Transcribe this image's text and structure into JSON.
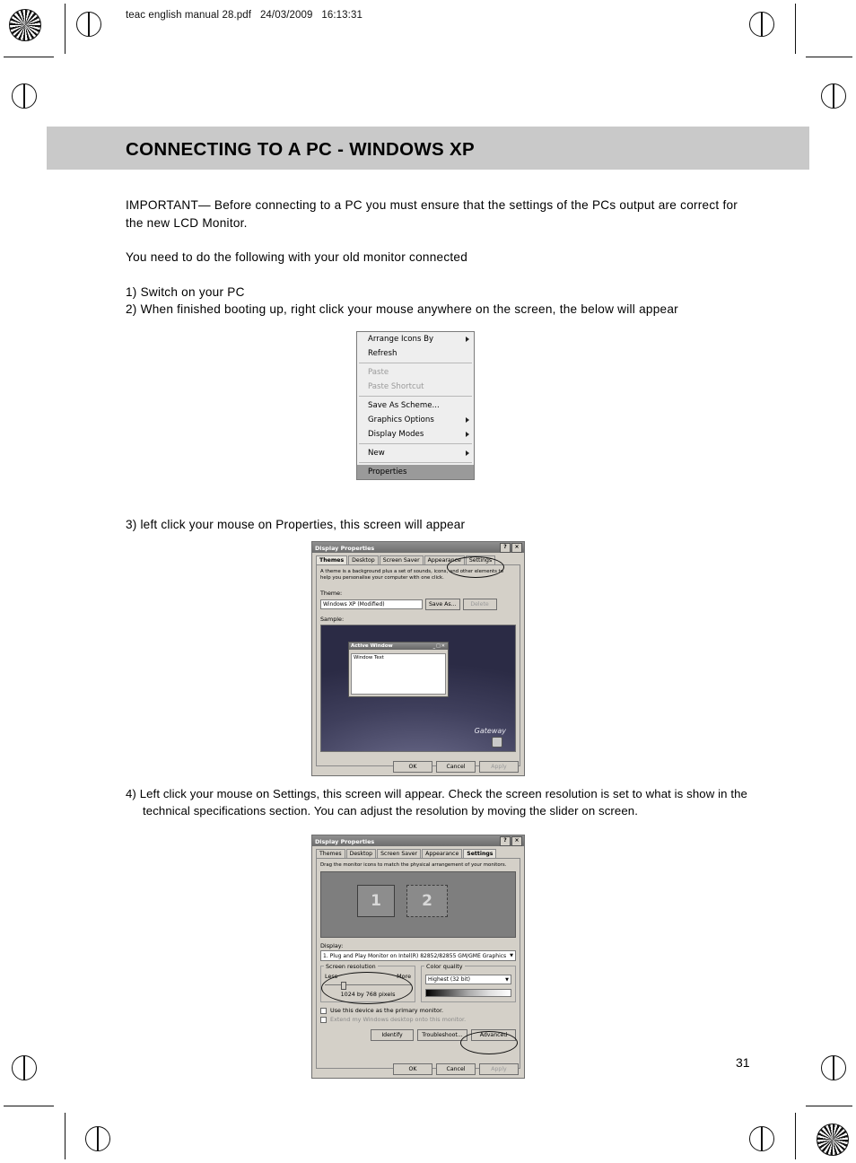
{
  "header": {
    "slug": "teac english manual 28.pdf   24/03/2009   16:13:31"
  },
  "title": "CONNECTING TO A PC - WINDOWS XP",
  "body": {
    "important": "IMPORTANT— Before connecting to a PC you must ensure that the settings of the PCs output are correct for the new LCD Monitor.",
    "line2": "You need to do the following with your old monitor connected",
    "step1": "1) Switch on your PC",
    "step2": "2) When finished booting up, right click your mouse anywhere on the screen, the below will appear",
    "step3": "3) left click your mouse on Properties, this screen will appear",
    "step4": "4) Left click your mouse on Settings, this screen will appear. Check the screen resolution is set to what is show in the technical specifications section. You can adjust the resolution by moving the slider on screen."
  },
  "page_number": "31",
  "context_menu": {
    "items": [
      {
        "label": "Arrange Icons By",
        "submenu": true,
        "disabled": false,
        "selected": false
      },
      {
        "label": "Refresh",
        "submenu": false,
        "disabled": false,
        "selected": false
      },
      {
        "label": "Paste",
        "submenu": false,
        "disabled": true,
        "selected": false
      },
      {
        "label": "Paste Shortcut",
        "submenu": false,
        "disabled": true,
        "selected": false
      },
      {
        "label": "Save As Scheme...",
        "submenu": false,
        "disabled": false,
        "selected": false
      },
      {
        "label": "Graphics Options",
        "submenu": true,
        "disabled": false,
        "selected": false
      },
      {
        "label": "Display Modes",
        "submenu": true,
        "disabled": false,
        "selected": false
      },
      {
        "label": "New",
        "submenu": true,
        "disabled": false,
        "selected": false
      },
      {
        "label": "Properties",
        "submenu": false,
        "disabled": false,
        "selected": true
      }
    ]
  },
  "themes_dialog": {
    "title": "Display Properties",
    "help_button": "?",
    "close_button": "×",
    "tabs": [
      "Themes",
      "Desktop",
      "Screen Saver",
      "Appearance",
      "Settings"
    ],
    "active_tab": "Themes",
    "description": "A theme is a background plus a set of sounds, icons, and other elements to help you personalise your computer with one click.",
    "theme_label": "Theme:",
    "theme_value": "Windows XP (Modified)",
    "save_as_button": "Save As...",
    "delete_button": "Delete",
    "sample_label": "Sample:",
    "sample_window_title": "Active Window",
    "sample_window_text": "Window Text",
    "sample_brand": "Gateway",
    "ok_button": "OK",
    "cancel_button": "Cancel",
    "apply_button": "Apply"
  },
  "settings_dialog": {
    "title": "Display Properties",
    "help_button": "?",
    "close_button": "×",
    "tabs": [
      "Themes",
      "Desktop",
      "Screen Saver",
      "Appearance",
      "Settings"
    ],
    "active_tab": "Settings",
    "instruction": "Drag the monitor icons to match the physical arrangement of your monitors.",
    "monitor_1": "1",
    "monitor_2": "2",
    "display_label": "Display:",
    "display_value": "1. Plug and Play Monitor on Intel(R) 82852/82855 GM/GME Graphics",
    "screen_resolution_label": "Screen resolution",
    "resolution_less": "Less",
    "resolution_more": "More",
    "resolution_value": "1024 by 768 pixels",
    "color_quality_label": "Color quality",
    "color_quality_value": "Highest (32 bit)",
    "primary_monitor_checkbox": "Use this device as the primary monitor.",
    "extend_checkbox": "Extend my Windows desktop onto this monitor.",
    "identify_button": "Identify",
    "troubleshoot_button": "Troubleshoot...",
    "advanced_button": "Advanced",
    "ok_button": "OK",
    "cancel_button": "Cancel",
    "apply_button": "Apply"
  }
}
